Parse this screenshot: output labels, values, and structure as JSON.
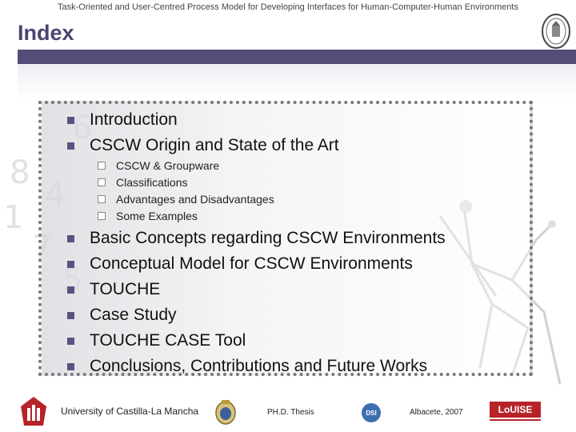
{
  "header": {
    "title": "Task-Oriented and User-Centred Process Model for Developing Interfaces for Human-Computer-Human Environments"
  },
  "page": {
    "title": "Index"
  },
  "index": {
    "items": [
      {
        "label": "Introduction"
      },
      {
        "label": "CSCW Origin and State of the Art",
        "subitems": [
          "CSCW & Groupware",
          "Classifications",
          "Advantages and Disadvantages",
          "Some Examples"
        ]
      },
      {
        "label": "Basic Concepts regarding CSCW Environments"
      },
      {
        "label": "Conceptual Model for CSCW Environments"
      },
      {
        "label": "TOUCHE"
      },
      {
        "label": "Case Study"
      },
      {
        "label": "TOUCHE CASE Tool"
      },
      {
        "label": "Conclusions, Contributions and Future Works"
      }
    ]
  },
  "background": {
    "numbers": [
      "6",
      "8",
      "4",
      "1",
      "7",
      "5"
    ]
  },
  "footer": {
    "university": "University of Castilla-La Mancha",
    "thesis": "PH.D. Thesis",
    "place_date": "Albacete, 2007",
    "dsi_logo_text": "DSI",
    "louise_logo_text": "LoUISE"
  },
  "colors": {
    "accent": "#564c78",
    "bullet": "#5a5280",
    "title": "#4d4472",
    "louise_red": "#b8232a"
  },
  "icons": [
    "university-seal-icon",
    "bullet-square-icon",
    "checkbox-icon",
    "uclm-logo-icon",
    "coat-of-arms-icon",
    "dsi-logo-icon",
    "louise-logo-icon"
  ]
}
